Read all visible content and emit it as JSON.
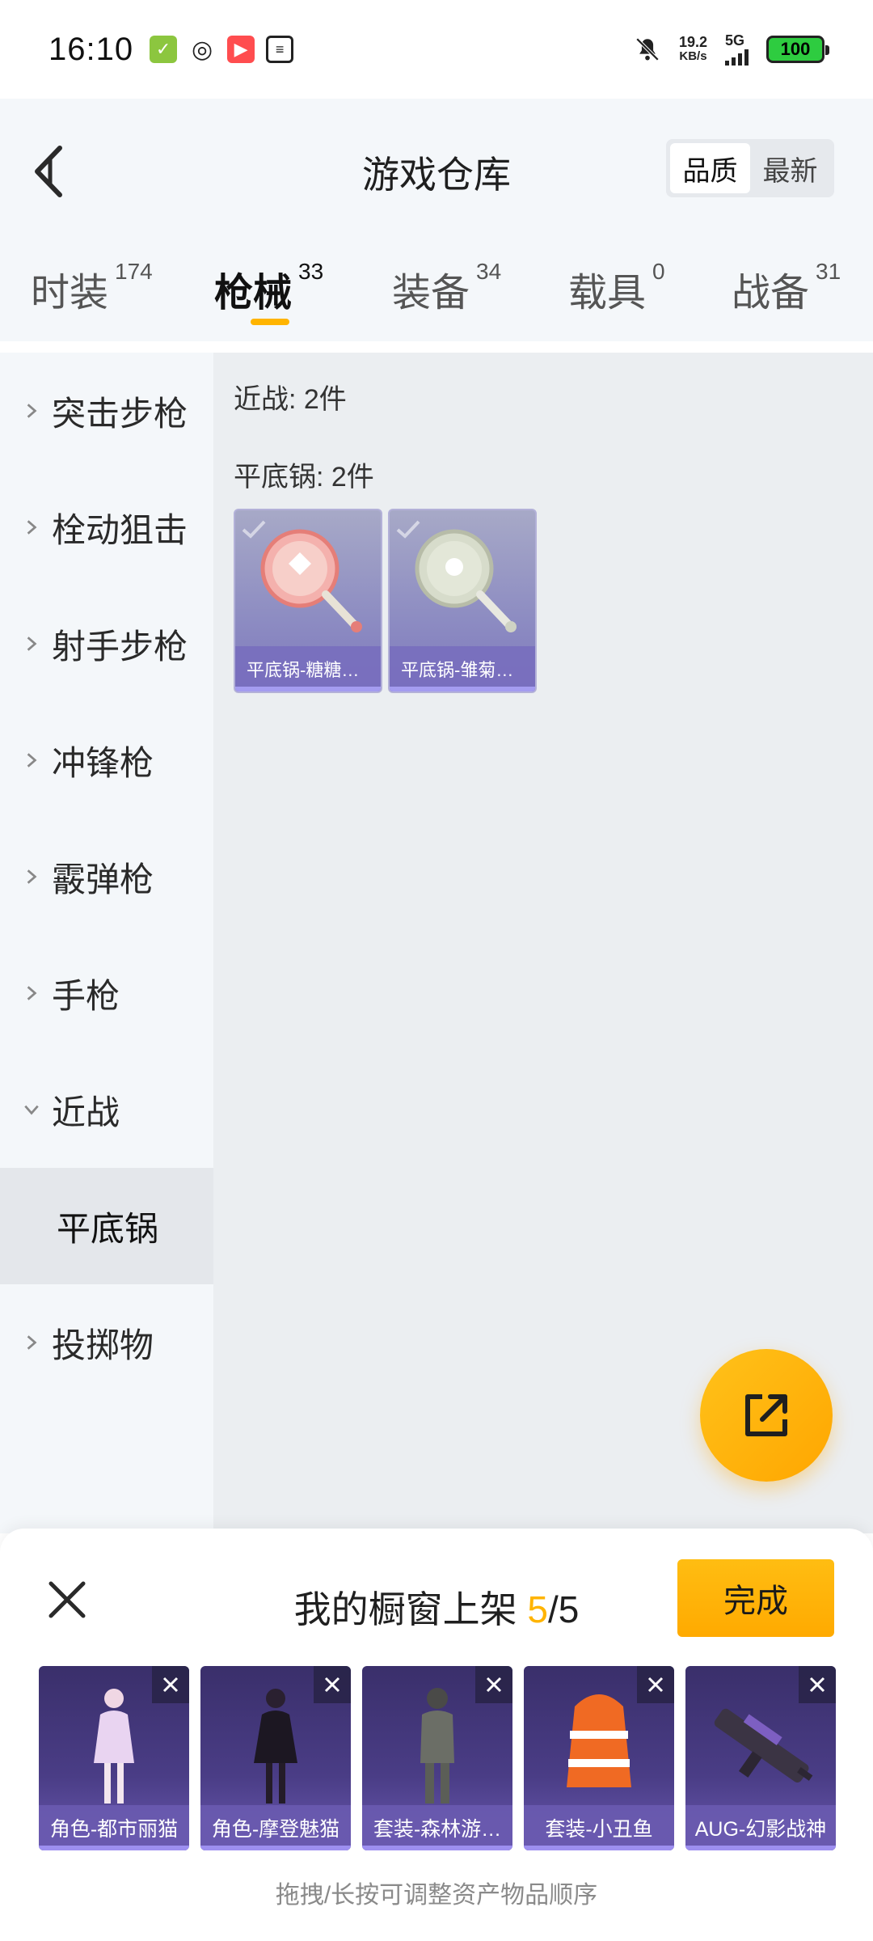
{
  "status_bar": {
    "time": "16:10",
    "net_speed_value": "19.2",
    "net_speed_unit": "KB/s",
    "network_type": "5G",
    "battery": "100"
  },
  "header": {
    "title": "游戏仓库",
    "sort_options": [
      "品质",
      "最新"
    ],
    "sort_active": "品质"
  },
  "tabs": [
    {
      "label": "时装",
      "count": "174"
    },
    {
      "label": "枪械",
      "count": "33"
    },
    {
      "label": "装备",
      "count": "34"
    },
    {
      "label": "载具",
      "count": "0"
    },
    {
      "label": "战备",
      "count": "31"
    }
  ],
  "sidebar": {
    "items": [
      {
        "label": "突击步枪"
      },
      {
        "label": "栓动狙击"
      },
      {
        "label": "射手步枪"
      },
      {
        "label": "冲锋枪"
      },
      {
        "label": "霰弹枪"
      },
      {
        "label": "手枪"
      },
      {
        "label": "近战"
      },
      {
        "label": "平底锅"
      },
      {
        "label": "投掷物"
      }
    ]
  },
  "content": {
    "category_count": "近战: 2件",
    "group_count": "平底锅: 2件",
    "items": [
      {
        "name": "平底锅-糖糖…"
      },
      {
        "name": "平底锅-雏菊…"
      }
    ]
  },
  "sheet": {
    "title_prefix": "我的橱窗上架",
    "current": "5",
    "separator": "/",
    "total": "5",
    "done_label": "完成",
    "items": [
      {
        "name": "角色-都市丽猫"
      },
      {
        "name": "角色-摩登魅猫"
      },
      {
        "name": "套装-森林游…"
      },
      {
        "name": "套装-小丑鱼"
      },
      {
        "name": "AUG-幻影战神"
      }
    ],
    "hint": "拖拽/长按可调整资产物品顺序"
  },
  "colors": {
    "accent": "#ffb400",
    "sidebar_bg": "#f4f7fa",
    "content_bg": "#ebeef1",
    "card_purple": "#8d8cc2"
  }
}
